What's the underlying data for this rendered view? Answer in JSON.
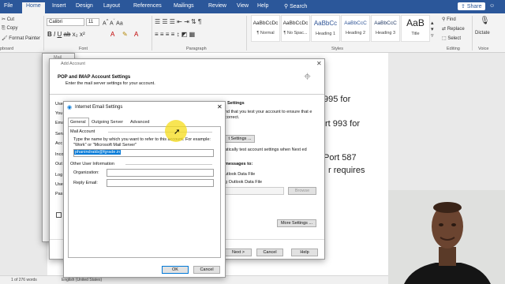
{
  "ribbon": {
    "tabs": [
      "File",
      "Home",
      "Insert",
      "Design",
      "Layout",
      "References",
      "Mailings",
      "Review",
      "View",
      "Help"
    ],
    "search": "Search",
    "share": "Share",
    "clipboard": {
      "cut": "Cut",
      "copy": "Copy",
      "format_painter": "Format Painter",
      "group": "pboard"
    },
    "font": {
      "name": "Calibri",
      "size": "11",
      "group": "Font"
    },
    "paragraph_group": "Paragraph",
    "styles": [
      {
        "preview": "AaBbCcDc",
        "name": "¶ Normal"
      },
      {
        "preview": "AaBbCcDc",
        "name": "¶ No Spac..."
      },
      {
        "preview": "AaBbCc",
        "name": "Heading 1"
      },
      {
        "preview": "AaBbCcC",
        "name": "Heading 2"
      },
      {
        "preview": "AaBbCcC",
        "name": "Heading 3"
      },
      {
        "preview": "AaB",
        "name": "Title"
      }
    ],
    "styles_group": "Styles",
    "editing": {
      "find": "Find",
      "replace": "Replace",
      "select": "Select",
      "group": "Editing"
    },
    "voice": {
      "dictate": "Dictate",
      "group": "Voice"
    }
  },
  "document": {
    "lines": [
      "995 for",
      "rt 993 for",
      "Port 587",
      "r requires"
    ]
  },
  "status": {
    "page": "1 of 276 words",
    "lang": "English (United States)"
  },
  "mail_bg": {
    "title": "Mail"
  },
  "add_account": {
    "title": "Add Account",
    "heading": "POP and IMAP Account Settings",
    "subheading": "Enter the mail server settings for your account.",
    "left_labels": [
      "Use",
      "You",
      "Ema",
      "Serv",
      "Acc",
      "Inco",
      "Out",
      "Log",
      "Use",
      "Pas"
    ],
    "test_heading": "Settings",
    "test_text": "nd that you test your account to ensure that e correct.",
    "test_button": "t Settings ...",
    "auto_test": "atically test account settings when Next ed",
    "deliver": "messages to:",
    "radio_new": "utlook Data File",
    "radio_existing": "g Outlook Data File",
    "browse": "Browse",
    "more_settings": "More Settings ...",
    "next": "Next >",
    "cancel": "Cancel",
    "help": "Help"
  },
  "ies": {
    "title": "Internet Email Settings",
    "tabs": [
      "General",
      "Outgoing Server",
      "Advanced"
    ],
    "mail_account_label": "Mail Account",
    "mail_account_desc": "Type the name by which you want to refer to this account. For example: \"Work\" or \"Microsoft Mail Server\"",
    "account_name": "phanindrakb@fgrade.in",
    "other_info_label": "Other User Information",
    "organization_label": "Organization:",
    "organization": "",
    "reply_label": "Reply Email:",
    "reply_email": "",
    "ok": "OK",
    "cancel": "Cancel"
  },
  "colors": {
    "word_blue": "#2b579a",
    "accent": "#0078d7",
    "cursor": "#f5dc1a"
  }
}
